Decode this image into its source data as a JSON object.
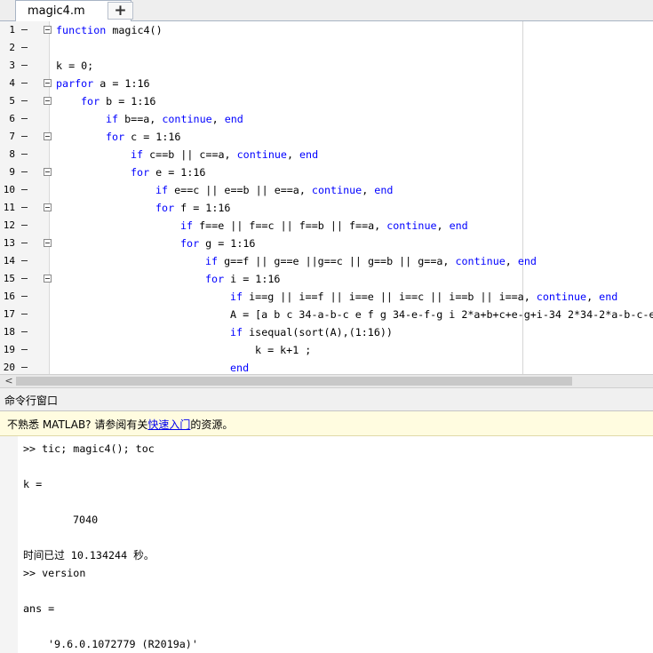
{
  "tabs": {
    "file_tab_label": "magic4.m",
    "close_symbol": "✕",
    "add_symbol": "+"
  },
  "editor": {
    "lines": [
      {
        "n": "1",
        "indent": 0,
        "fold": true,
        "segments": [
          {
            "t": "function",
            "kw": true
          },
          {
            "t": " magic4()"
          }
        ]
      },
      {
        "n": "2",
        "indent": 0,
        "fold": false,
        "segments": []
      },
      {
        "n": "3",
        "indent": 0,
        "fold": false,
        "segments": [
          {
            "t": "k = 0;"
          }
        ]
      },
      {
        "n": "4",
        "indent": 0,
        "fold": true,
        "segments": [
          {
            "t": "parfor",
            "kw": true
          },
          {
            "t": " a = 1:16"
          }
        ]
      },
      {
        "n": "5",
        "indent": 1,
        "fold": true,
        "segments": [
          {
            "t": "for",
            "kw": true
          },
          {
            "t": " b = 1:16"
          }
        ]
      },
      {
        "n": "6",
        "indent": 2,
        "fold": false,
        "segments": [
          {
            "t": "if",
            "kw": true
          },
          {
            "t": " b==a, "
          },
          {
            "t": "continue",
            "kw": true
          },
          {
            "t": ", "
          },
          {
            "t": "end",
            "kw": true
          }
        ]
      },
      {
        "n": "7",
        "indent": 2,
        "fold": true,
        "segments": [
          {
            "t": "for",
            "kw": true
          },
          {
            "t": " c = 1:16"
          }
        ]
      },
      {
        "n": "8",
        "indent": 3,
        "fold": false,
        "segments": [
          {
            "t": "if",
            "kw": true
          },
          {
            "t": " c==b || c==a, "
          },
          {
            "t": "continue",
            "kw": true
          },
          {
            "t": ", "
          },
          {
            "t": "end",
            "kw": true
          }
        ]
      },
      {
        "n": "9",
        "indent": 3,
        "fold": true,
        "segments": [
          {
            "t": "for",
            "kw": true
          },
          {
            "t": " e = 1:16"
          }
        ]
      },
      {
        "n": "10",
        "indent": 4,
        "fold": false,
        "segments": [
          {
            "t": "if",
            "kw": true
          },
          {
            "t": " e==c || e==b || e==a, "
          },
          {
            "t": "continue",
            "kw": true
          },
          {
            "t": ", "
          },
          {
            "t": "end",
            "kw": true
          }
        ]
      },
      {
        "n": "11",
        "indent": 4,
        "fold": true,
        "segments": [
          {
            "t": "for",
            "kw": true
          },
          {
            "t": " f = 1:16"
          }
        ]
      },
      {
        "n": "12",
        "indent": 5,
        "fold": false,
        "segments": [
          {
            "t": "if",
            "kw": true
          },
          {
            "t": " f==e || f==c || f==b || f==a, "
          },
          {
            "t": "continue",
            "kw": true
          },
          {
            "t": ", "
          },
          {
            "t": "end",
            "kw": true
          }
        ]
      },
      {
        "n": "13",
        "indent": 5,
        "fold": true,
        "segments": [
          {
            "t": "for",
            "kw": true
          },
          {
            "t": " g = 1:16"
          }
        ]
      },
      {
        "n": "14",
        "indent": 6,
        "fold": false,
        "segments": [
          {
            "t": "if",
            "kw": true
          },
          {
            "t": " g==f || g==e ||g==c || g==b || g==a, "
          },
          {
            "t": "continue",
            "kw": true
          },
          {
            "t": ", "
          },
          {
            "t": "end",
            "kw": true
          }
        ]
      },
      {
        "n": "15",
        "indent": 6,
        "fold": true,
        "segments": [
          {
            "t": "for",
            "kw": true
          },
          {
            "t": " i = 1:16"
          }
        ]
      },
      {
        "n": "16",
        "indent": 7,
        "fold": false,
        "segments": [
          {
            "t": "if",
            "kw": true
          },
          {
            "t": " i==g || i==f || i==e || i==c || i==b || i==a, "
          },
          {
            "t": "continue",
            "kw": true
          },
          {
            "t": ", "
          },
          {
            "t": "end",
            "kw": true
          }
        ]
      },
      {
        "n": "17",
        "indent": 7,
        "fold": false,
        "segments": [
          {
            "t": "A = [a b c 34-a-b-c e f g 34-e-f-g i 2*a+b+c+e-g+i-34 2*34-2*a-b-c-e"
          }
        ]
      },
      {
        "n": "18",
        "indent": 7,
        "fold": false,
        "segments": [
          {
            "t": "if",
            "kw": true
          },
          {
            "t": " isequal(sort(A),(1:16))"
          }
        ]
      },
      {
        "n": "19",
        "indent": 8,
        "fold": false,
        "segments": [
          {
            "t": "k = k+1 ;"
          }
        ]
      },
      {
        "n": "20",
        "indent": 7,
        "fold": false,
        "segments": [
          {
            "t": "end",
            "kw": true
          }
        ]
      }
    ]
  },
  "scrollbar": {
    "left_arrow": "<"
  },
  "command_window": {
    "title": "命令行窗口",
    "banner_prefix": "不熟悉 MATLAB? 请参阅有关",
    "banner_link": "快速入门",
    "banner_suffix": "的资源。",
    "lines": [
      {
        "text": ">> tic; magic4(); toc",
        "indent": 0
      },
      {
        "text": "",
        "indent": 0
      },
      {
        "text": "k =",
        "indent": 0
      },
      {
        "text": "",
        "indent": 0
      },
      {
        "text": "7040",
        "indent": 1
      },
      {
        "text": "",
        "indent": 0
      },
      {
        "text": "时间已过 10.134244 秒。",
        "indent": 0
      },
      {
        "text": ">> version",
        "indent": 0
      },
      {
        "text": "",
        "indent": 0
      },
      {
        "text": "ans =",
        "indent": 0
      },
      {
        "text": "",
        "indent": 0
      },
      {
        "text": "'9.6.0.1072779 (R2019a)'",
        "indent": 2
      }
    ]
  }
}
